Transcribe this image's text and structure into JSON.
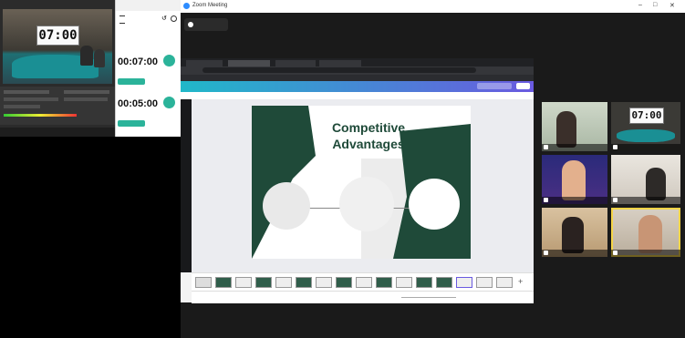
{
  "timer_clock": "07:00",
  "timer_app": {
    "header": "",
    "rows": [
      {
        "time": "00:07:00",
        "label": "",
        "action": ""
      },
      {
        "time": "00:05:00",
        "label": "",
        "action": ""
      }
    ]
  },
  "zoom": {
    "title": "Zoom Meeting",
    "recording": "",
    "window_controls": [
      "–",
      "□",
      "✕"
    ]
  },
  "browser": {
    "tabs": [
      "",
      "",
      "",
      ""
    ],
    "address": ""
  },
  "slide": {
    "title_line1": "Competitive",
    "title_line2": "Advantages",
    "circle_left": "",
    "circle_middle": "",
    "circle_right": "",
    "circle_right_emphasis": "",
    "page_number": ""
  },
  "participants": [
    {
      "name": ""
    },
    {
      "name": "",
      "clock": "07:00"
    },
    {
      "name": ""
    },
    {
      "name": ""
    },
    {
      "name": ""
    },
    {
      "name": ""
    }
  ],
  "colors": {
    "slide_green": "#1f4a39",
    "zoom_dark": "#1a1a1a",
    "accent_teal": "#2bb39a",
    "active_speaker": "#f5d547"
  }
}
